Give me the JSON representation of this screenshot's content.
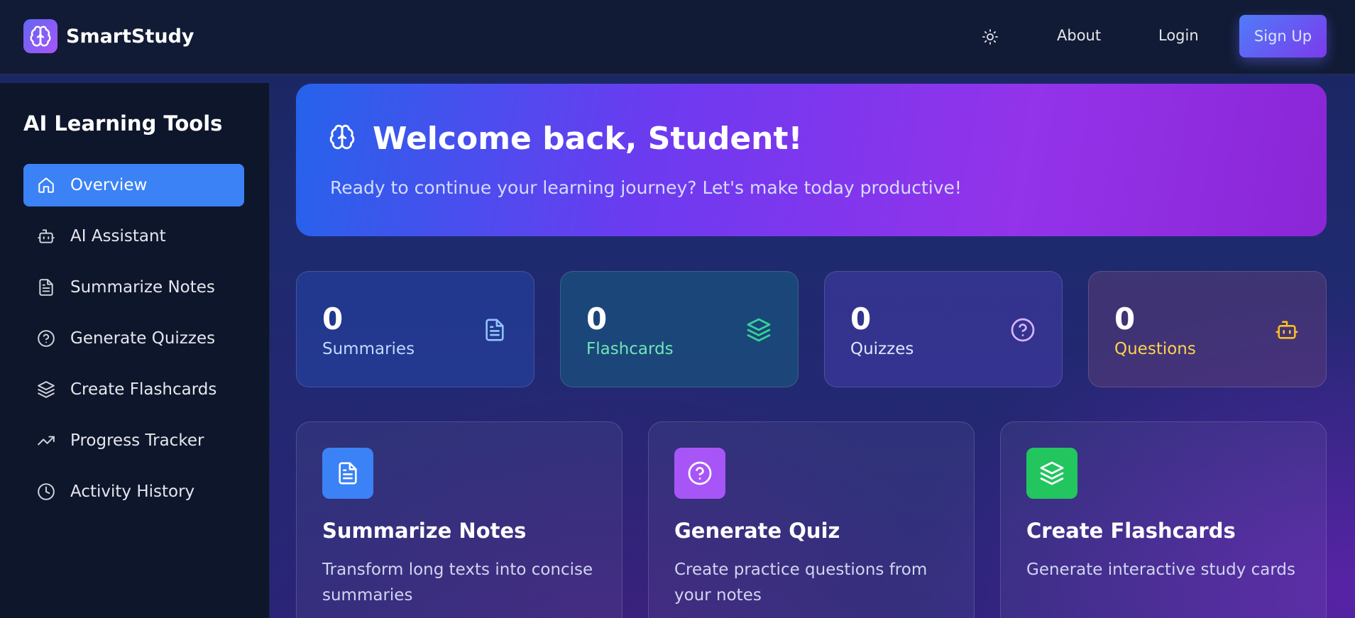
{
  "app": {
    "name": "SmartStudy"
  },
  "navbar": {
    "theme_icon": "sun-icon",
    "about_label": "About",
    "login_label": "Login",
    "signup_label": "Sign Up"
  },
  "sidebar": {
    "title": "AI Learning Tools",
    "items": [
      {
        "label": "Overview",
        "icon": "home-icon",
        "active": true
      },
      {
        "label": "AI Assistant",
        "icon": "bot-icon"
      },
      {
        "label": "Summarize Notes",
        "icon": "document-icon"
      },
      {
        "label": "Generate Quizzes",
        "icon": "question-circle-icon"
      },
      {
        "label": "Create Flashcards",
        "icon": "layers-icon"
      },
      {
        "label": "Progress Tracker",
        "icon": "trending-up-icon"
      },
      {
        "label": "Activity History",
        "icon": "clock-icon"
      }
    ]
  },
  "hero": {
    "title": "Welcome back, Student!",
    "subtitle": "Ready to continue your learning journey? Let's make today productive!"
  },
  "stats": [
    {
      "value": "0",
      "label": "Summaries",
      "color": "#bfdbfe",
      "icon_color": "#93c5fd"
    },
    {
      "value": "0",
      "label": "Flashcards",
      "color": "#6ee7b7",
      "icon_color": "#34d399"
    },
    {
      "value": "0",
      "label": "Quizzes",
      "color": "#e0e7ff",
      "icon_color": "#d8b4fe"
    },
    {
      "value": "0",
      "label": "Questions",
      "color": "#fcd34d",
      "icon_color": "#fbbf24"
    }
  ],
  "features": [
    {
      "title": "Summarize Notes",
      "description": "Transform long texts into concise summaries",
      "icon_bg": "#3b82f6"
    },
    {
      "title": "Generate Quiz",
      "description": "Create practice questions from your notes",
      "icon_bg": "#a855f7"
    },
    {
      "title": "Create Flashcards",
      "description": "Generate interactive study cards",
      "icon_bg": "#22c55e"
    }
  ]
}
